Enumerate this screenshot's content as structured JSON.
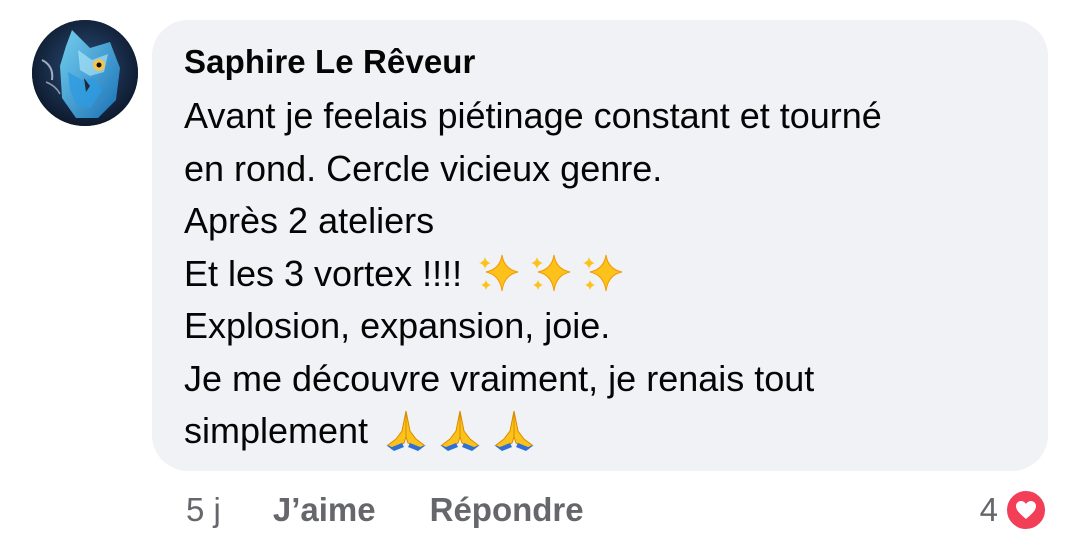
{
  "comment": {
    "author": "Saphire Le Rêveur",
    "lines": [
      "Avant je feelais piétinage constant et tourné",
      "en rond. Cercle vicieux genre.",
      "Après 2 ateliers",
      "Et les 3 vortex !!!!",
      "Explosion, expansion, joie.",
      "Je me découvre vraiment, je renais tout",
      "simplement"
    ],
    "emojis": {
      "line4": [
        "sparkles-icon",
        "sparkles-icon",
        "sparkles-icon"
      ],
      "line7": [
        "folded-hands-icon",
        "folded-hands-icon",
        "folded-hands-icon"
      ]
    }
  },
  "actions": {
    "time": "5 j",
    "like_label": "J’aime",
    "reply_label": "Répondre"
  },
  "reactions": {
    "count": "4",
    "type": "heart-icon"
  },
  "colors": {
    "bubble_bg": "#f0f2f5",
    "text": "#050505",
    "secondary_text": "#65676b",
    "heart": "#f33e58"
  }
}
